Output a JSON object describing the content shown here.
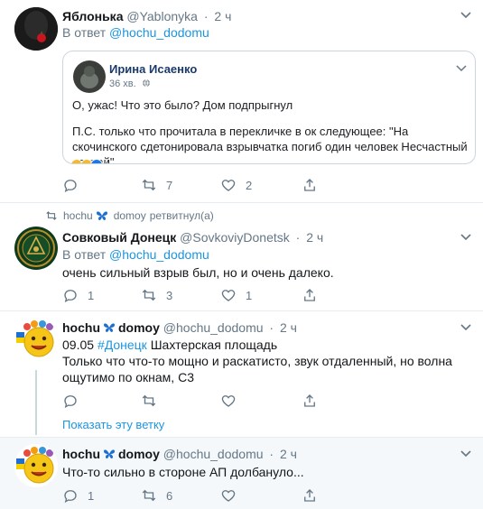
{
  "colors": {
    "link": "#1b95e0",
    "muted": "#657786",
    "border": "#e6ecf0",
    "shaded_bg": "#f5f8fa"
  },
  "tweets": [
    {
      "name": "Яблонька",
      "handle": "@Yablonyka",
      "dot": "·",
      "time": "2 ч",
      "reply_prefix": "В ответ",
      "reply_to": "@hochu_dodomu",
      "quote": {
        "name": "Ирина Исаенко",
        "time": "36 хв.",
        "text1": "О, ужас! Что это было? Дом подпрыгнул",
        "text2": "П.С. только что прочитала в перекличке в ок следующее: \"На скочинского сдетонировала взрывчатка погиб один человек Несчастный случай\""
      },
      "counts": {
        "reply": "",
        "retweet": "7",
        "like": "2"
      }
    },
    {
      "retweeted_by_name_a": "hochu",
      "retweeted_by_name_b": "domoy",
      "retweeted_suffix": "ретвитнул(а)",
      "name": "Совковый Донецк",
      "handle": "@SovkoviyDonetsk",
      "dot": "·",
      "time": "2 ч",
      "reply_prefix": "В ответ",
      "reply_to": "@hochu_dodomu",
      "text": "очень сильный взрыв был, но и очень далеко.",
      "counts": {
        "reply": "1",
        "retweet": "3",
        "like": "1"
      }
    },
    {
      "name_a": "hochu",
      "name_b": "domoy",
      "handle": "@hochu_dodomu",
      "dot": "·",
      "time": "2 ч",
      "text_date": "09.05",
      "hashtag": "#Донецк",
      "text_rest": "Шахтерская  площадь",
      "text_line2": "Только что что-то мощно и раскатисто, звук отдаленный, но волна ощутимо по окнам, С3",
      "show_thread": "Показать эту ветку",
      "counts": {
        "reply": "",
        "retweet": "",
        "like": ""
      }
    },
    {
      "name_a": "hochu",
      "name_b": "domoy",
      "handle": "@hochu_dodomu",
      "dot": "·",
      "time": "2 ч",
      "text": "Что-то сильно в стороне АП долбануло...",
      "counts": {
        "reply": "1",
        "retweet": "6",
        "like": ""
      }
    }
  ]
}
